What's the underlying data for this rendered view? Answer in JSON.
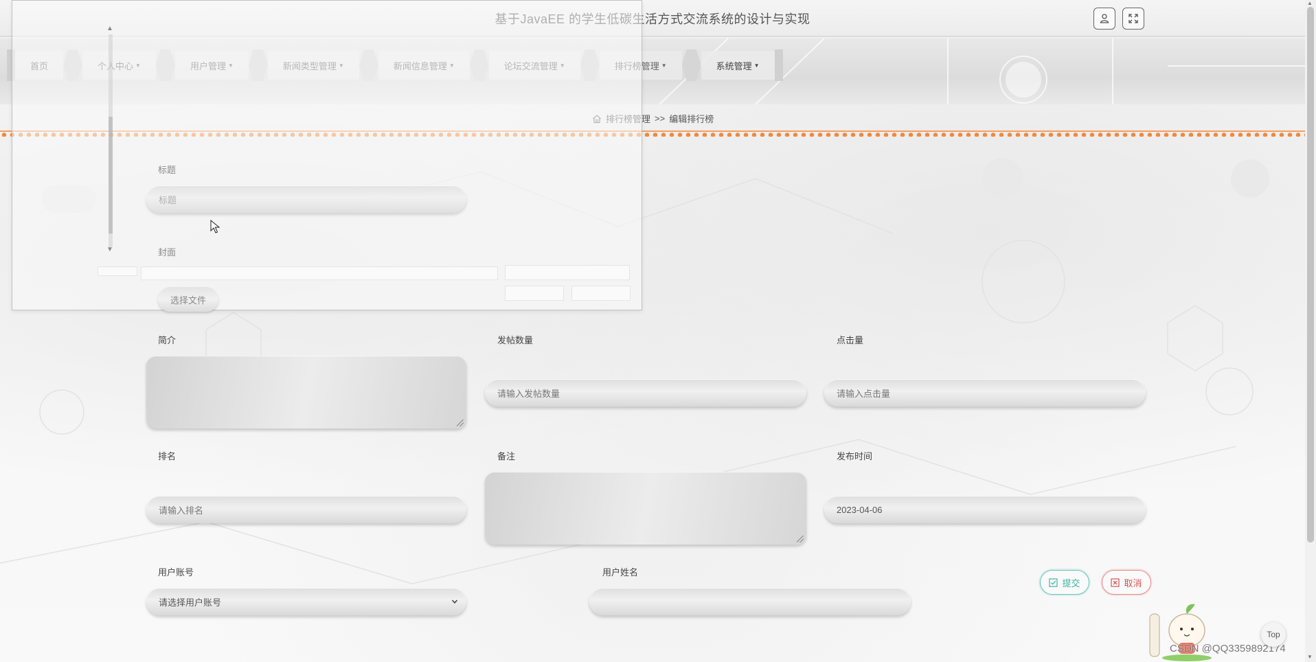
{
  "header": {
    "title": "基于JavaEE 的学生低碳生活方式交流系统的设计与实现",
    "user_icon": "user-icon",
    "fullscreen_icon": "fullscreen-icon"
  },
  "nav": {
    "items": [
      {
        "label": "首页",
        "dropdown": false
      },
      {
        "label": "个人中心",
        "dropdown": true
      },
      {
        "label": "用户管理",
        "dropdown": true
      },
      {
        "label": "新闻类型管理",
        "dropdown": true
      },
      {
        "label": "新闻信息管理",
        "dropdown": true
      },
      {
        "label": "论坛交流管理",
        "dropdown": true
      },
      {
        "label": "排行榜管理",
        "dropdown": true
      },
      {
        "label": "系统管理",
        "dropdown": true
      }
    ]
  },
  "breadcrumb": {
    "section": "排行榜管理",
    "separator": ">>",
    "page": "编辑排行榜"
  },
  "form": {
    "title": {
      "label": "标题",
      "placeholder": "标题"
    },
    "cover": {
      "label": "封面",
      "button": "选择文件"
    },
    "intro": {
      "label": "简介"
    },
    "post_count": {
      "label": "发帖数量",
      "placeholder": "请输入发帖数量"
    },
    "clicks": {
      "label": "点击量",
      "placeholder": "请输入点击量"
    },
    "rank": {
      "label": "排名",
      "placeholder": "请输入排名"
    },
    "remark": {
      "label": "备注"
    },
    "publish_time": {
      "label": "发布时间",
      "value": "2023-04-06"
    },
    "user_account": {
      "label": "用户账号",
      "selected": "请选择用户账号"
    },
    "user_name": {
      "label": "用户姓名",
      "value": ""
    },
    "submit": "提交",
    "cancel": "取消"
  },
  "misc": {
    "top_button": "Top",
    "watermark": "CSDN @QQ3359892174"
  },
  "colors": {
    "accent_orange": "#f08a3c",
    "submit_teal": "#3bb3a1",
    "cancel_red": "#d65252"
  }
}
